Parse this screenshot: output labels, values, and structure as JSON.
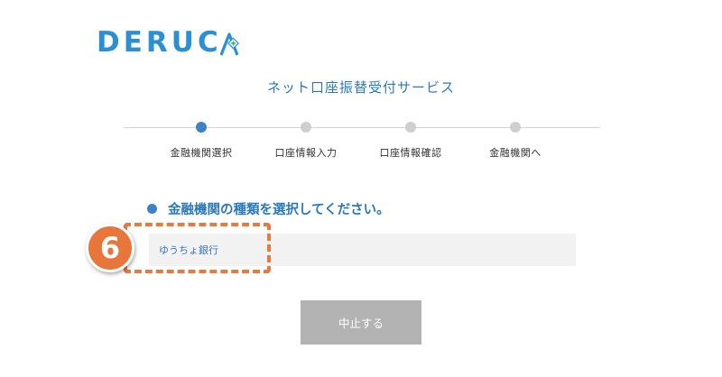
{
  "brand": {
    "logo_text": "DERUCA",
    "logo_color": "#2b8fd4",
    "logo_mark_icon": "diamond-plus-icon"
  },
  "service": {
    "title": "ネット口座振替受付サービス"
  },
  "stepper": {
    "steps": [
      {
        "label": "金融機関選択",
        "active": true
      },
      {
        "label": "口座情報入力",
        "active": false
      },
      {
        "label": "口座情報確認",
        "active": false
      },
      {
        "label": "金融機関へ",
        "active": false
      }
    ],
    "active_color": "#3b83c6",
    "inactive_color": "#cfcfcf"
  },
  "form": {
    "prompt": "金融機関の種類を選択してください。",
    "bank_type_value": "ゆうちょ銀行"
  },
  "annotation": {
    "step_number": "6",
    "accent_color": "#e8763a"
  },
  "actions": {
    "cancel_label": "中止する"
  }
}
